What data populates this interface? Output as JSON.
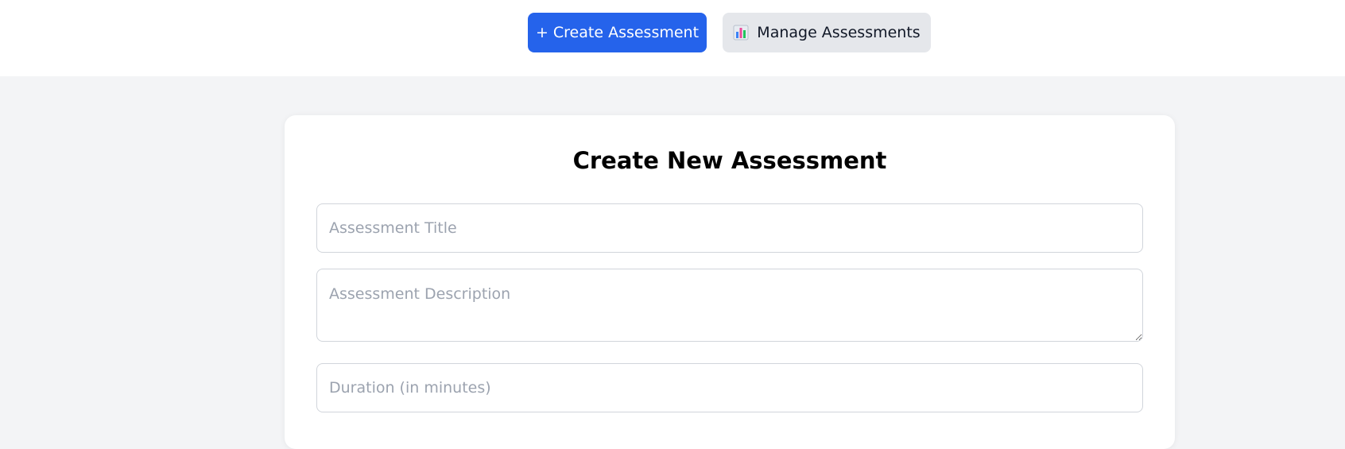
{
  "header": {
    "create_button_label": "+ Create Assessment",
    "manage_button_label": "Manage Assessments",
    "manage_icon": "bar-chart-icon"
  },
  "form": {
    "heading": "Create New Assessment",
    "title_placeholder": "Assessment Title",
    "title_value": "",
    "description_placeholder": "Assessment Description",
    "description_value": "",
    "duration_placeholder": "Duration (in minutes)",
    "duration_value": ""
  },
  "colors": {
    "primary": "#2563eb",
    "secondary_button": "#e5e7eb",
    "page_background": "#f3f4f6",
    "card_background": "#ffffff"
  }
}
